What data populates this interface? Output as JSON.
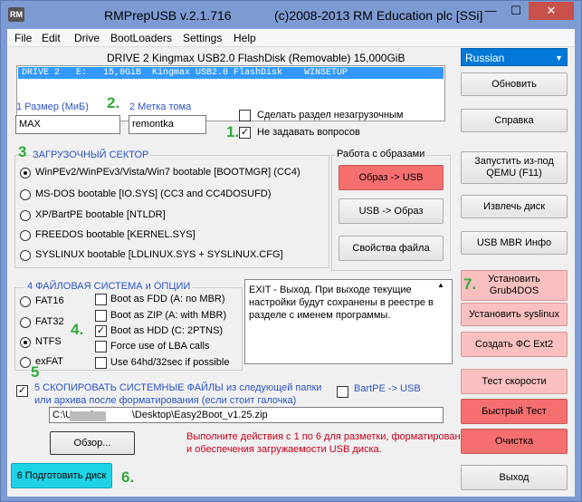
{
  "window": {
    "app_icon": "RM",
    "title_app": "RMPrepUSB v.2.1.716",
    "title_copyright": "(c)2008-2013 RM Education plc [SSi]",
    "minimize": "—",
    "maximize": "☐",
    "close": "✕"
  },
  "menu": [
    "File",
    "Edit",
    "Drive",
    "BootLoaders",
    "Settings",
    "Help"
  ],
  "drive_header": "DRIVE  2 Kingmax USB2.0 FlashDisk  (Removable) 15,000GiB",
  "drive_list": [
    "DRIVE 2   E:   15,0GiB  Kingmax USB2.0 FlashDisk    WINSETUP"
  ],
  "language": "Russian",
  "size_label": "1 Размер (МиБ)",
  "size_value": "MAX",
  "volume_label": "2 Метка тома",
  "volume_value": "remontka",
  "chk_nonboot": "Сделать раздел незагрузочным",
  "chk_noask": "Не задавать вопросов",
  "boot_sector": {
    "title": "ЗАГРУЗОЧНЫЙ СЕКТОР",
    "options": [
      "WinPEv2/WinPEv3/Vista/Win7 bootable [BOOTMGR] (CC4)",
      "MS-DOS bootable [IO.SYS]    (CC3 and CC4DOSUFD)",
      "XP/BartPE bootable [NTLDR]",
      "FREEDOS bootable [KERNEL.SYS]",
      "SYSLINUX bootable [LDLINUX.SYS + SYSLINUX.CFG]"
    ],
    "selected": 0
  },
  "image_group": {
    "title": "Работа с образами",
    "btn_img_to_usb": "Образ -> USB",
    "btn_usb_to_img": "USB -> Образ",
    "btn_file_props": "Свойства файла"
  },
  "fs_group": {
    "title": "4 ФАЙЛОВАЯ СИСТЕМА и ОПЦИИ",
    "fs": [
      "FAT16",
      "FAT32",
      "NTFS",
      "exFAT"
    ],
    "selected": 2,
    "opts": [
      {
        "label": "Boot as FDD (A: no MBR)",
        "checked": false
      },
      {
        "label": "Boot as ZIP (A: with MBR)",
        "checked": false
      },
      {
        "label": "Boot as HDD (C: 2PTNS)",
        "checked": true
      },
      {
        "label": "Force use of LBA calls",
        "checked": false
      },
      {
        "label": "Use 64hd/32sec if possible",
        "checked": false
      }
    ]
  },
  "memo_text": "EXIT - Выход. При выходе текущие настройки будут сохранены в реестре в разделе с именем программы.",
  "copy_label_1": "5 СКОПИРОВАТЬ СИСТЕМНЫЕ ФАЙЛЫ из следующей папки",
  "copy_label_2": "или архива после форматирования (если стоит галочка)",
  "bartpe": "BartPE -> USB",
  "path_prefix": "C:\\Users\\",
  "path_suffix": "\\Desktop\\Easy2Boot_v1.25.zip",
  "browse": "Обзор...",
  "info_1": "Выполните действия с 1 по 6 для разметки, форматирования",
  "info_2": "и обеспечения загружаемости USB диска.",
  "prepare": "6 Подготовить диск",
  "right_buttons": {
    "refresh": "Обновить",
    "help": "Справка",
    "qemu": "Запустить из-под QEMU (F11)",
    "eject": "Извлечь диск",
    "mbr": "USB MBR Инфо",
    "grub": "Установить Grub4DOS",
    "syslinux": "Установить syslinux",
    "ext2": "Создать ФС Ext2",
    "speed": "Тест скорости",
    "quick": "Быстрый Тест",
    "clean": "Очистка",
    "exit": "Выход"
  },
  "step_numbers": [
    "1.",
    "2.",
    "3",
    "4.",
    "5",
    "6.",
    "7."
  ],
  "colors": {
    "accent_green": "#2eaa3b",
    "label_blue": "#2b55c7",
    "red_button": "#f56f6f",
    "pink_button": "#fac0c0",
    "cyan_button": "#1ed3e6",
    "selection_blue": "#3399ff"
  }
}
